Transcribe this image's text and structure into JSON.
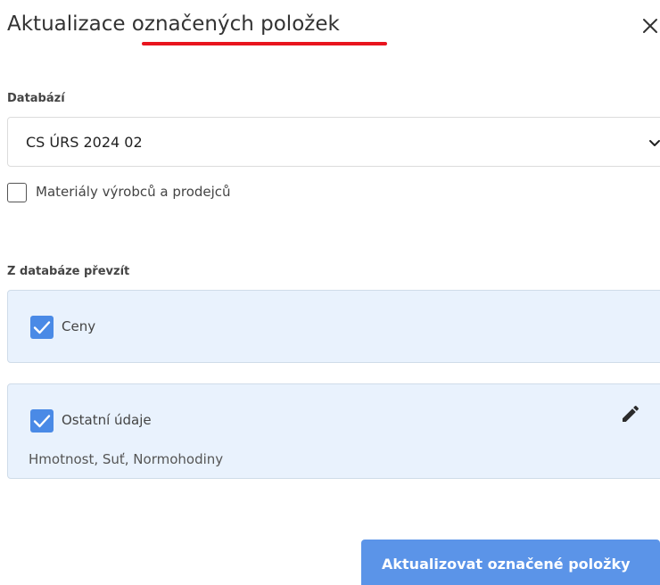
{
  "dialog": {
    "title": "Aktualizace označených položek",
    "close_icon": "close-icon"
  },
  "database": {
    "label": "Databází",
    "selected": "CS ÚRS 2024 02",
    "chevron_icon": "chevron-down-icon"
  },
  "materials_checkbox": {
    "label": "Materiály výrobců a prodejců",
    "checked": false
  },
  "take_over": {
    "label": "Z databáze převzít",
    "options": [
      {
        "label": "Ceny",
        "checked": true
      },
      {
        "label": "Ostatní údaje",
        "checked": true,
        "details": "Hmotnost, Suť, Normohodiny",
        "edit_icon": "pencil-icon"
      }
    ]
  },
  "actions": {
    "submit_label": "Aktualizovat označené položky"
  },
  "colors": {
    "accent": "#4a8ae6",
    "button": "#5b94e8",
    "panel_bg": "#e9f2fd",
    "underline": "#e8141e"
  }
}
